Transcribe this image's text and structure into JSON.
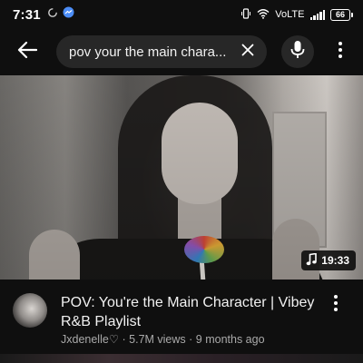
{
  "status_bar": {
    "time": "7:31",
    "network_label": "VoLTE",
    "battery": "66"
  },
  "search": {
    "query": "pov your the main chara..."
  },
  "video": {
    "duration": "19:33",
    "title": "POV: You're the Main Character | Vibey R&B Playlist",
    "channel": "Jxdenelle♡",
    "views": "5.7M views",
    "age": "9 months ago",
    "meta_separator": " · "
  },
  "icons": {
    "back": "arrow-back-icon",
    "clear": "close-icon",
    "mic": "microphone-icon",
    "more": "more-vert-icon",
    "music": "music-note-icon"
  },
  "colors": {
    "background": "#0f0f0f",
    "search_box": "#272727",
    "secondary_text": "#aaaaaa"
  }
}
